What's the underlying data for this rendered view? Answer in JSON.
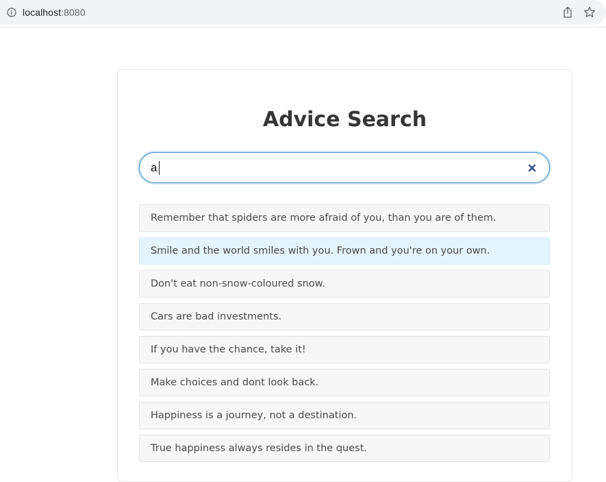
{
  "browser": {
    "url_host": "localhost",
    "url_port": ":8080",
    "icons": [
      "info-icon",
      "share-icon",
      "star-icon"
    ]
  },
  "page": {
    "title": "Advice Search"
  },
  "search": {
    "value": "a",
    "clear_icon": "close-icon",
    "accent_color": "#3e8ed0"
  },
  "results": {
    "highlight_color": "#e4f4fc",
    "highlighted_index": 1,
    "items": [
      "Remember that spiders are more afraid of you, than you are of them.",
      "Smile and the world smiles with you. Frown and you're on your own.",
      "Don't eat non-snow-coloured snow.",
      "Cars are bad investments.",
      "If you have the chance, take it!",
      "Make choices and dont look back.",
      "Happiness is a journey, not a destination.",
      "True happiness always resides in the quest."
    ]
  }
}
